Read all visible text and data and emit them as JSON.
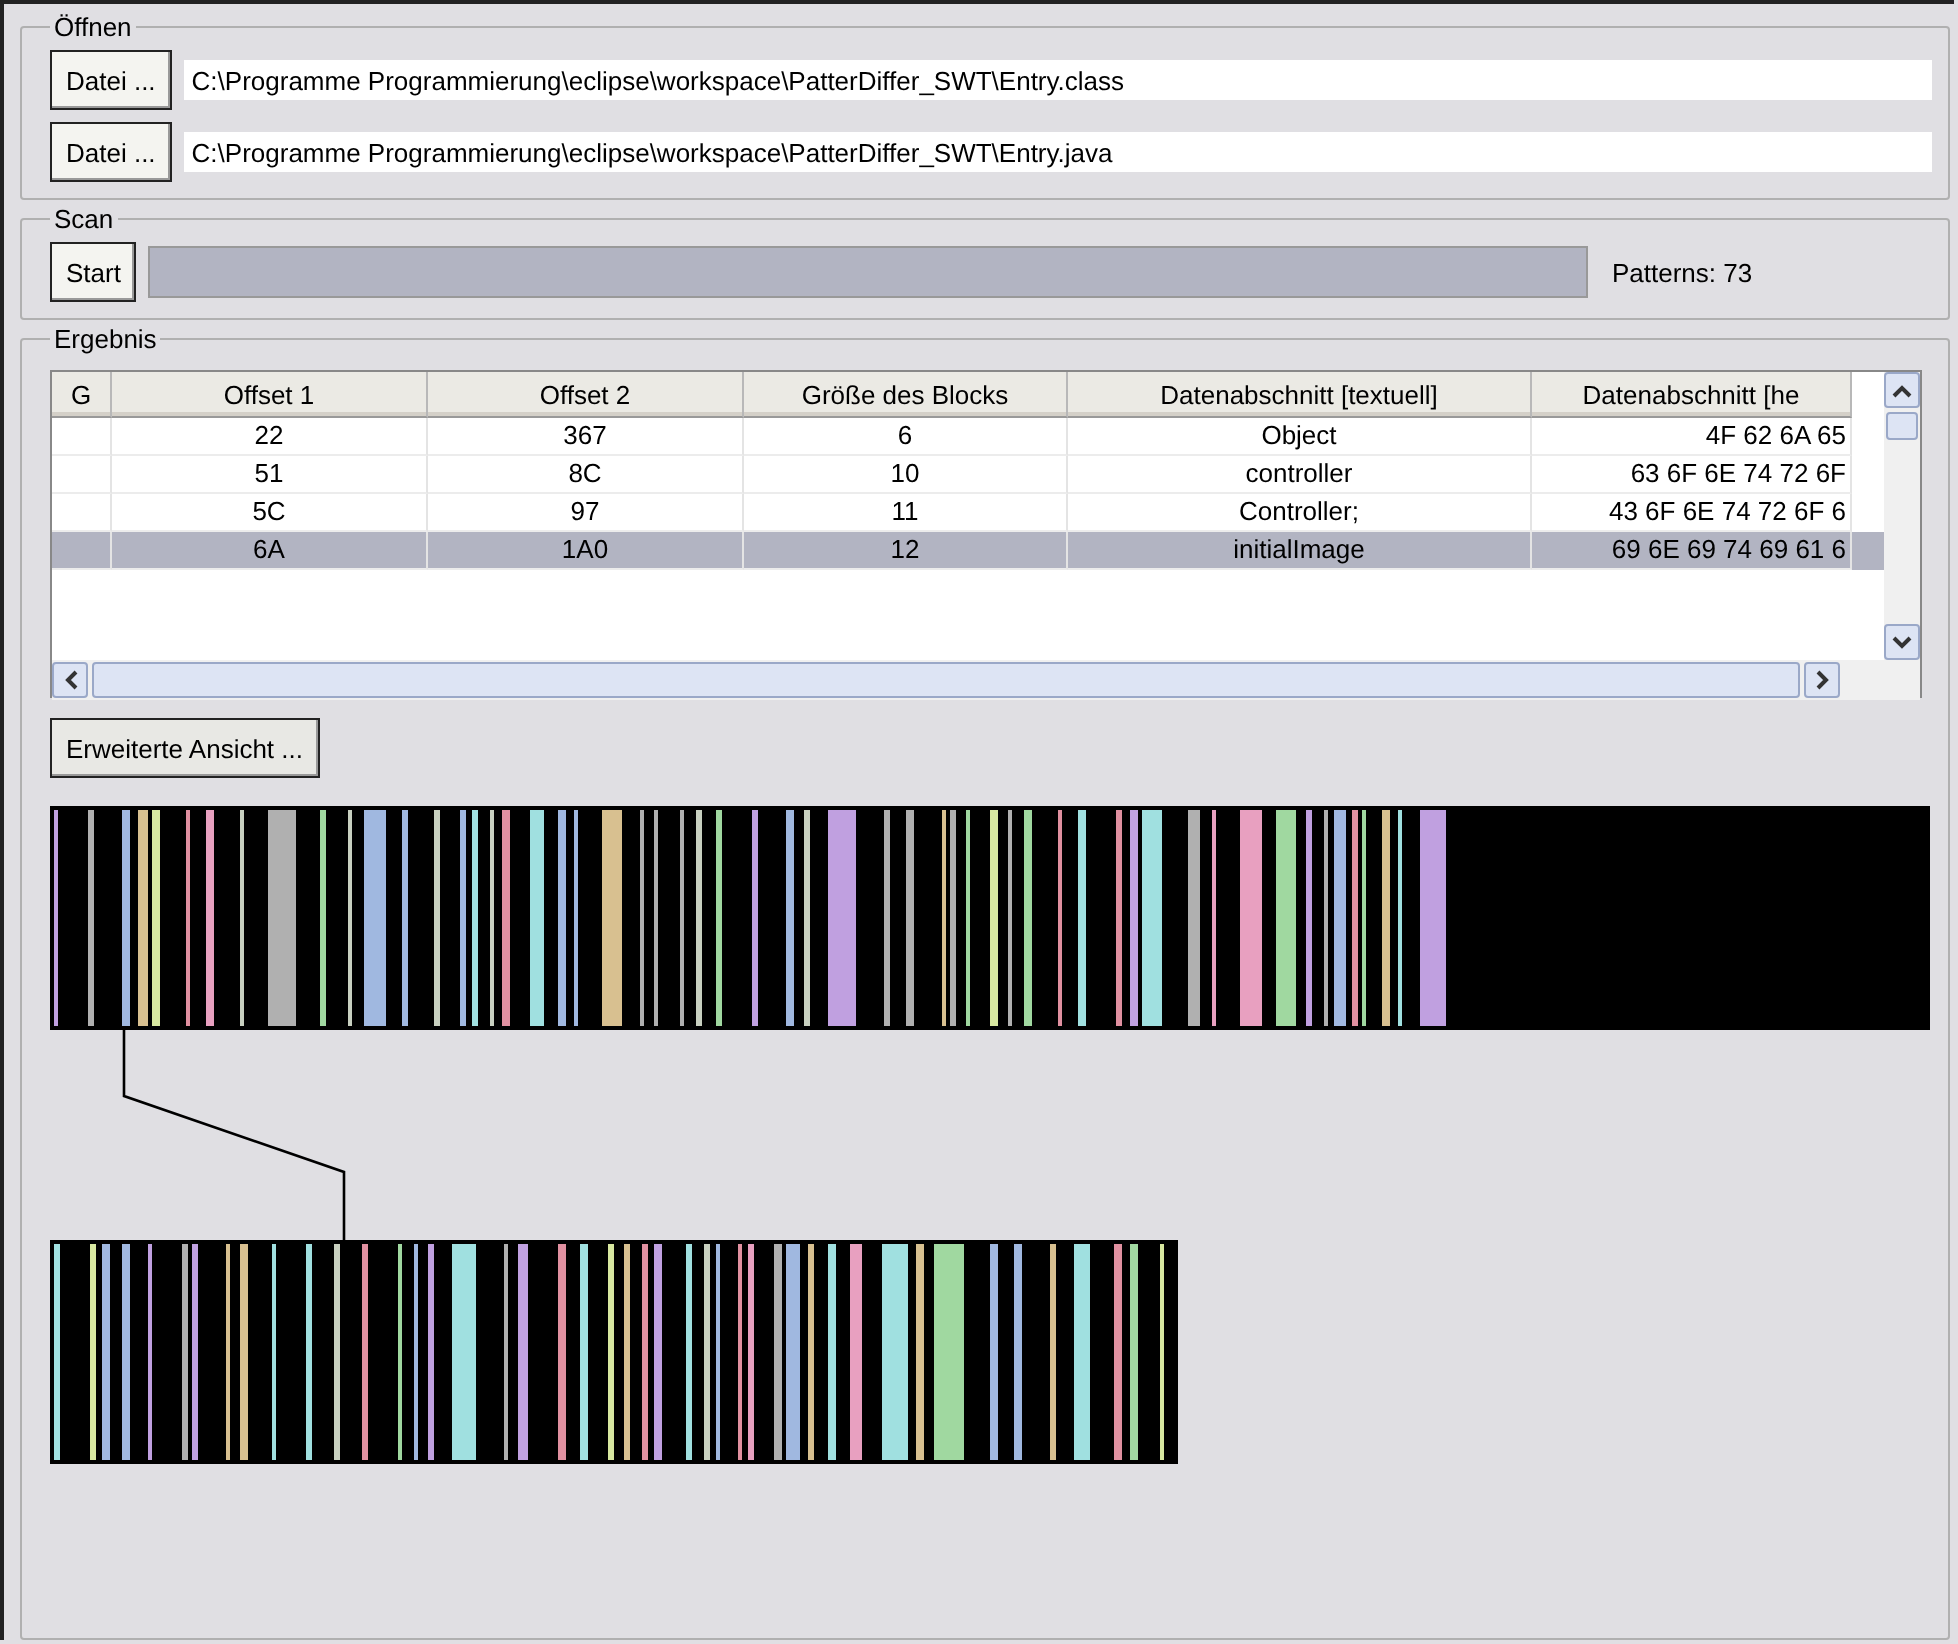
{
  "open_group": {
    "title": "Öffnen",
    "files": [
      {
        "button": "Datei ...",
        "path": "C:\\Programme Programmierung\\eclipse\\workspace\\PatterDiffer_SWT\\Entry.class"
      },
      {
        "button": "Datei ...",
        "path": "C:\\Programme Programmierung\\eclipse\\workspace\\PatterDiffer_SWT\\Entry.java"
      }
    ]
  },
  "scan_group": {
    "title": "Scan",
    "button": "Start",
    "level": 1,
    "patterns": "Patterns: 73"
  },
  "result_group": {
    "title": "Ergebnis",
    "table": {
      "columns": [
        "G",
        "Offset 1",
        "Offset 2",
        "Größe des Blocks",
        "Datenabschnitt [textuell]",
        "Datenabschnitt [he"
      ],
      "rows": [
        {
          "cells": [
            "",
            "22",
            "367",
            "6",
            "Object",
            "4F 62 6A 65"
          ],
          "selected": false
        },
        {
          "cells": [
            "",
            "51",
            "8C",
            "10",
            "controller",
            "63 6F 6E 74 72 6F"
          ],
          "selected": false
        },
        {
          "cells": [
            "",
            "5C",
            "97",
            "11",
            "Controller;",
            "43 6F 6E 74 72 6F 6"
          ],
          "selected": false
        },
        {
          "cells": [
            "",
            "6A",
            "1A0",
            "12",
            "initialImage",
            "69 6E 69 74 69 61 6"
          ],
          "selected": true
        }
      ]
    },
    "extended_button": "Erweiterte Ansicht ..."
  }
}
